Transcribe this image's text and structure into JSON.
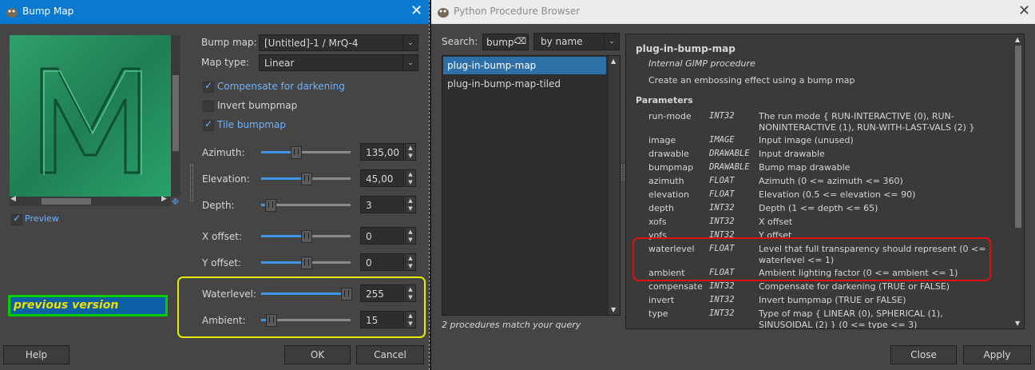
{
  "bump_dialog": {
    "title": "Bump Map",
    "preview_letter": "M",
    "preview_label": "Preview",
    "annotation_label": "previous version",
    "bump_map_label": "Bump map:",
    "bump_map_value": "[Untitled]-1 / MrQ-4",
    "map_type_label": "Map type:",
    "map_type_value": "Linear",
    "compensate_label": "Compensate for darkening",
    "invert_label": "Invert bumpmap",
    "tile_label": "Tile bumpmap",
    "sliders": [
      {
        "label": "Azimuth:",
        "value": "135,00",
        "fraction": 0.37
      },
      {
        "label": "Elevation:",
        "value": "45,00",
        "fraction": 0.5
      },
      {
        "label": "Depth:",
        "value": "3",
        "fraction": 0.05
      },
      {
        "label": "X offset:",
        "value": "0",
        "fraction": 0.5
      },
      {
        "label": "Y offset:",
        "value": "0",
        "fraction": 0.5
      },
      {
        "label": "Waterlevel:",
        "value": "255",
        "fraction": 1.0
      },
      {
        "label": "Ambient:",
        "value": "15",
        "fraction": 0.06
      }
    ],
    "help_button": "Help",
    "ok_button": "OK",
    "cancel_button": "Cancel"
  },
  "browser": {
    "title": "Python Procedure Browser",
    "search_label": "Search:",
    "search_value": "bump-",
    "sort_value": "by name",
    "procedures": [
      "plug-in-bump-map",
      "plug-in-bump-map-tiled"
    ],
    "match_text": "2 procedures match your query",
    "proc_name": "plug-in-bump-map",
    "proc_kind": "Internal GIMP procedure",
    "proc_desc": "Create an embossing effect using a bump map",
    "params_heading": "Parameters",
    "params": [
      {
        "name": "run-mode",
        "type": "INT32",
        "desc": "The run mode { RUN-INTERACTIVE (0), RUN-NONINTERACTIVE (1), RUN-WITH-LAST-VALS (2) }"
      },
      {
        "name": "image",
        "type": "IMAGE",
        "desc": "Input image (unused)"
      },
      {
        "name": "drawable",
        "type": "DRAWABLE",
        "desc": "Input drawable"
      },
      {
        "name": "bumpmap",
        "type": "DRAWABLE",
        "desc": "Bump map drawable"
      },
      {
        "name": "azimuth",
        "type": "FLOAT",
        "desc": "Azimuth (0 <= azimuth <= 360)"
      },
      {
        "name": "elevation",
        "type": "FLOAT",
        "desc": "Elevation (0.5 <= elevation <= 90)"
      },
      {
        "name": "depth",
        "type": "INT32",
        "desc": "Depth (1 <= depth <= 65)"
      },
      {
        "name": "xofs",
        "type": "INT32",
        "desc": "X offset"
      },
      {
        "name": "yofs",
        "type": "INT32",
        "desc": "Y offset"
      },
      {
        "name": "waterlevel",
        "type": "FLOAT",
        "desc": "Level that full transparency should represent (0 <= waterlevel <= 1)"
      },
      {
        "name": "ambient",
        "type": "FLOAT",
        "desc": "Ambient lighting factor (0 <= ambient <= 1)"
      },
      {
        "name": "compensate",
        "type": "INT32",
        "desc": "Compensate for darkening (TRUE or FALSE)"
      },
      {
        "name": "invert",
        "type": "INT32",
        "desc": "Invert bumpmap (TRUE or FALSE)"
      },
      {
        "name": "type",
        "type": "INT32",
        "desc": "Type of map { LINEAR (0), SPHERICAL (1), SINUSOIDAL (2) } (0 <= type <= 3)"
      }
    ],
    "close_button": "Close",
    "apply_button": "Apply"
  },
  "colors": {
    "accent": "#0b79d0",
    "highlight_yellow": "#e8e800",
    "highlight_red": "#e01010",
    "annotation_green": "#00cc00",
    "annotation_text": "#f0e000"
  }
}
